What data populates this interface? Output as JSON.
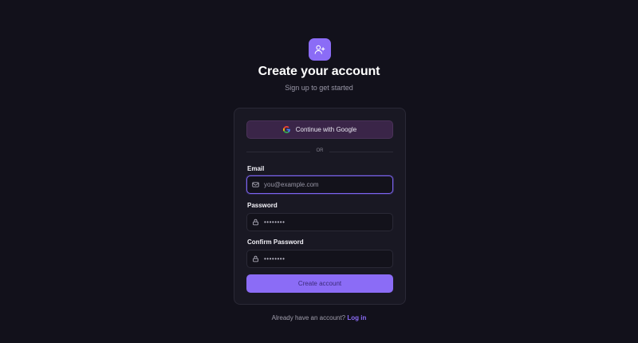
{
  "header": {
    "icon": "user-plus-icon",
    "title": "Create your account",
    "subtitle": "Sign up to get started"
  },
  "form": {
    "google_button_label": "Continue with Google",
    "divider_text": "OR",
    "email": {
      "label": "Email",
      "placeholder": "you@example.com",
      "icon": "mail-icon"
    },
    "password": {
      "label": "Password",
      "value_masked": "••••••••",
      "icon": "lock-icon"
    },
    "confirm_password": {
      "label": "Confirm Password",
      "value_masked": "••••••••",
      "icon": "lock-icon"
    },
    "submit_label": "Create account"
  },
  "footer": {
    "prompt": "Already have an account?",
    "link_label": "Log in"
  },
  "colors": {
    "accent": "#8b6cf6",
    "background": "#12111b",
    "card": "#191823",
    "google_button": "#3a2548"
  }
}
